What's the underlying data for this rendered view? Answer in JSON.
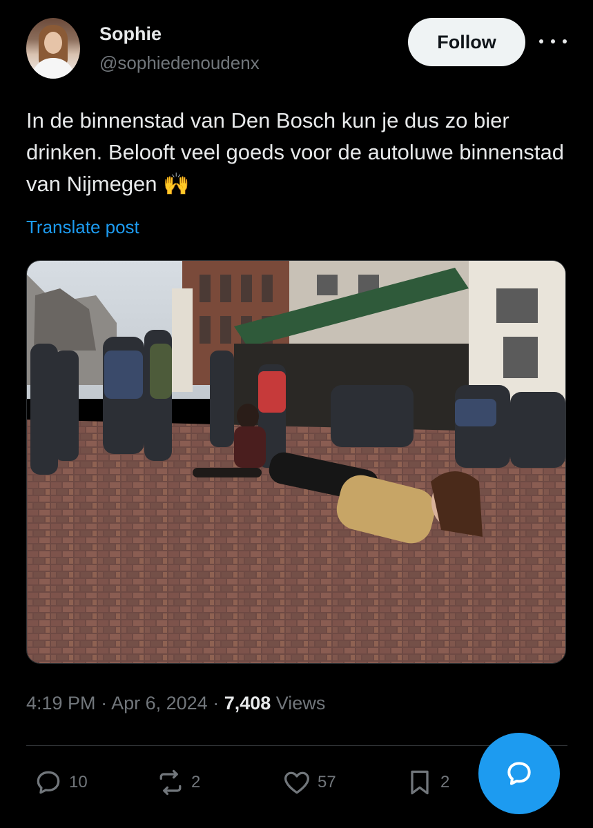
{
  "author": {
    "name": "Sophie",
    "handle": "@sophiedenoudenx"
  },
  "header": {
    "follow_label": "Follow"
  },
  "post": {
    "text": "In de binnenstad van Den Bosch kun je dus zo bier drinken. Belooft veel goeds voor de autoluwe binnenstad van Nijmegen 🙌",
    "translate_label": "Translate post",
    "media_icon": "photo-street-scene"
  },
  "meta": {
    "time": "4:19 PM",
    "date": "Apr 6, 2024",
    "separator": " · ",
    "views_count": "7,408",
    "views_label": "Views"
  },
  "actions": {
    "replies": "10",
    "reposts": "2",
    "likes": "57",
    "bookmarks": "2"
  },
  "colors": {
    "background": "#000000",
    "text": "#e7e9ea",
    "secondary": "#71767b",
    "accent": "#1d9bf0",
    "follow_bg": "#eff3f4"
  }
}
